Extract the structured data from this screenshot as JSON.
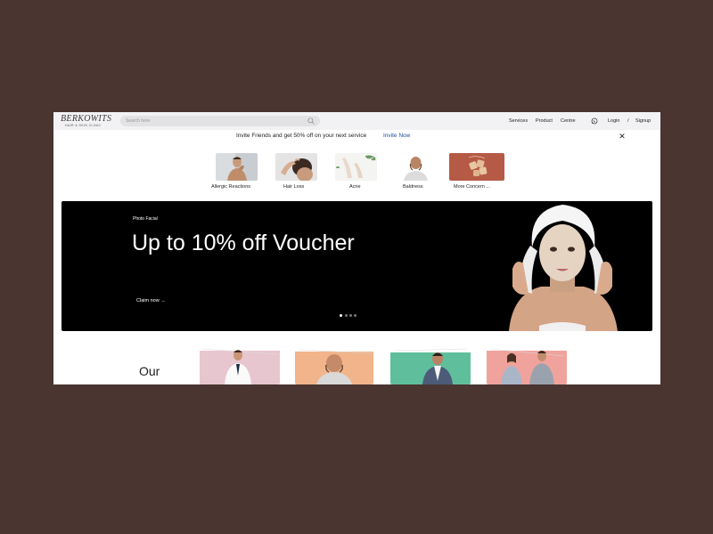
{
  "header": {
    "logo_main": "BERKOWITS",
    "logo_sub": "HAIR & SKIN CLINIC",
    "search_placeholder": "Search here",
    "nav": [
      "Services",
      "Product",
      "Centre"
    ],
    "login": "Login",
    "separator": "/",
    "signup": "Signup"
  },
  "invite": {
    "text": "Invite Friends and get 50% off on your next service",
    "link": "Invite Now",
    "close": "✕"
  },
  "concerns": [
    {
      "label": "Allergic  Reactions",
      "icon": "allergic-reactions-image"
    },
    {
      "label": "Hair Loss",
      "icon": "hair-loss-image"
    },
    {
      "label": "Acne",
      "icon": "acne-image"
    },
    {
      "label": "Baldness",
      "icon": "baldness-image"
    },
    {
      "label": "More  Concern ...",
      "icon": "more-concerns-image"
    }
  ],
  "hero": {
    "tag": "Photo Facial",
    "title": "Up to 10% off Voucher",
    "cta": "Claim now →",
    "slides": 4,
    "active_slide": 1
  },
  "section": {
    "title": "Our"
  },
  "cards": [
    {
      "icon": "doctor-image",
      "color": "#e8c6cf"
    },
    {
      "icon": "bald-patient-image",
      "color": "#f2b48a"
    },
    {
      "icon": "consultant-image",
      "color": "#5fbf9c"
    },
    {
      "icon": "consultation-image",
      "color": "#f0a39c"
    }
  ]
}
